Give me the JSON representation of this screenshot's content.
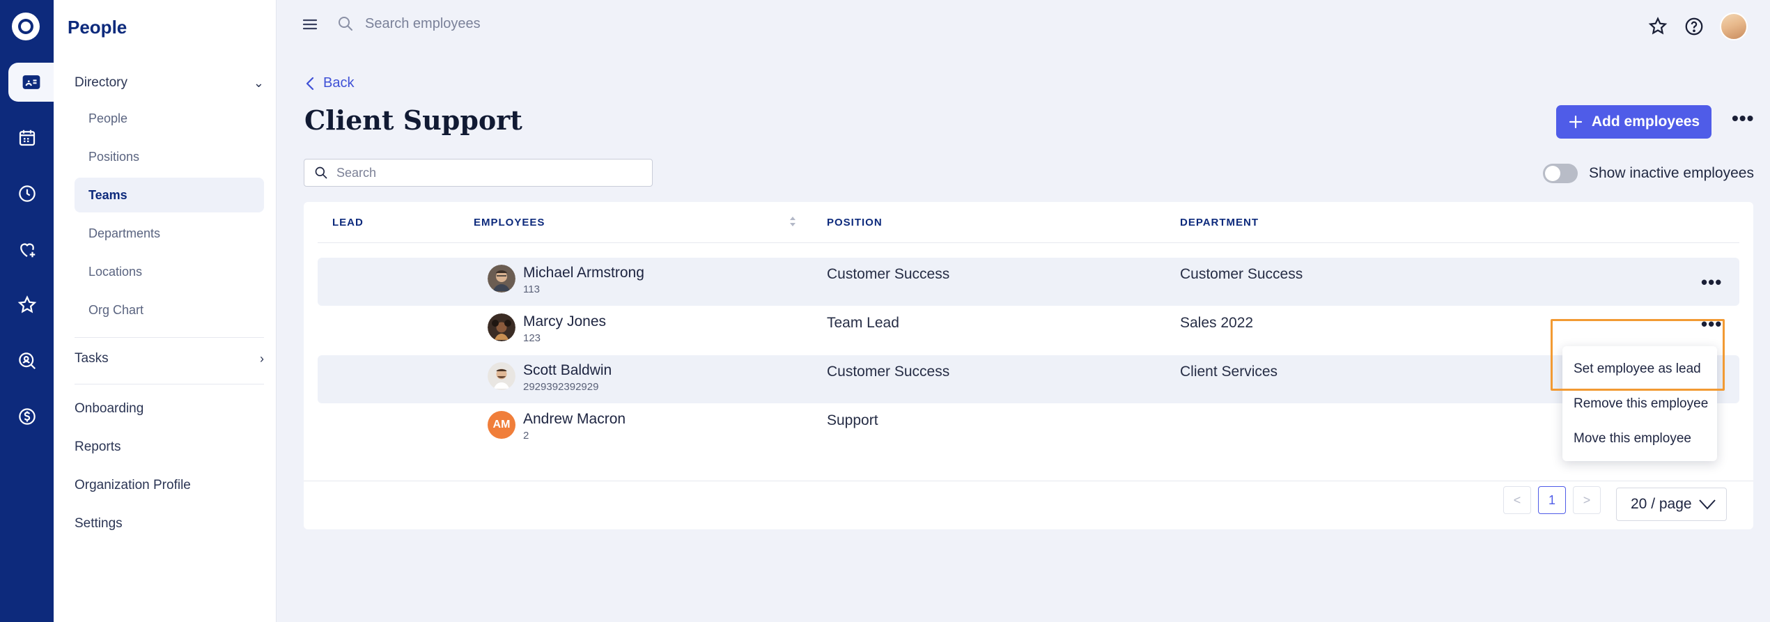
{
  "app": {
    "title": "People"
  },
  "rail": {
    "items": [
      {
        "icon": "app-logo"
      },
      {
        "icon": "id-card-icon",
        "active": true
      },
      {
        "icon": "calendar-icon"
      },
      {
        "icon": "clock-icon"
      },
      {
        "icon": "heart-plus-icon"
      },
      {
        "icon": "star-icon"
      },
      {
        "icon": "search-person-icon"
      },
      {
        "icon": "dollar-icon"
      }
    ]
  },
  "sidebar": {
    "directory_label": "Directory",
    "directory_items": [
      {
        "label": "People"
      },
      {
        "label": "Positions"
      },
      {
        "label": "Teams",
        "active": true
      },
      {
        "label": "Departments"
      },
      {
        "label": "Locations"
      },
      {
        "label": "Org Chart"
      }
    ],
    "tasks_label": "Tasks",
    "onboarding_label": "Onboarding",
    "reports_label": "Reports",
    "org_profile_label": "Organization Profile",
    "settings_label": "Settings"
  },
  "topbar": {
    "search_placeholder": "Search employees"
  },
  "page": {
    "back_label": "Back",
    "title": "Client Support",
    "add_button_label": "Add employees",
    "search_placeholder": "Search",
    "toggle_label": "Show inactive employees",
    "toggle_on": false
  },
  "table": {
    "headers": {
      "lead": "LEAD",
      "employees": "EMPLOYEES",
      "position": "POSITION",
      "department": "DEPARTMENT"
    },
    "rows": [
      {
        "name": "Michael Armstrong",
        "id": "113",
        "position": "Customer Success",
        "department": "Customer Success",
        "avatar": "photo"
      },
      {
        "name": "Marcy Jones",
        "id": "123",
        "position": "Team Lead",
        "department": "Sales 2022",
        "avatar": "photo"
      },
      {
        "name": "Scott Baldwin",
        "id": "2929392392929",
        "position": "Customer Success",
        "department": "Client Services",
        "avatar": "photo"
      },
      {
        "name": "Andrew Macron",
        "id": "2",
        "position": "Support",
        "department": "",
        "avatar": "AM"
      }
    ]
  },
  "pagination": {
    "prev": "<",
    "current": "1",
    "next": ">",
    "page_size": "20 / page"
  },
  "row_menu": {
    "items": [
      {
        "label": "Set employee as lead"
      },
      {
        "label": "Remove this employee"
      },
      {
        "label": "Move this employee"
      }
    ]
  },
  "colors": {
    "rail": "#0d2a7c",
    "accent": "#4f5ce8",
    "highlight": "#f29a33",
    "initials_avatar": "#f07e3a"
  }
}
